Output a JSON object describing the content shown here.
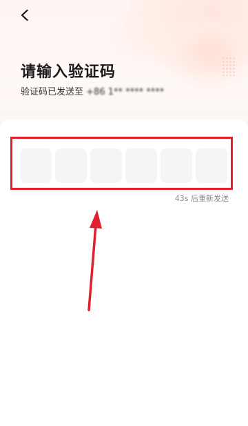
{
  "header": {
    "back_icon": "chevron-left-icon"
  },
  "main": {
    "title": "请输入验证码",
    "subtitle_prefix": "验证码已发送至",
    "phone_number": "+86 1** **** ****",
    "code_length": 6,
    "code_digits": [
      "",
      "",
      "",
      "",
      "",
      ""
    ],
    "resend_countdown": "43s",
    "resend_label": "后重新发送"
  },
  "annotation": {
    "highlight_color": "#e0202c",
    "arrow_color": "#e0202c"
  },
  "colors": {
    "accent": "#e0202c",
    "title_text": "#1a1a1a",
    "code_box_bg": "#f5f5f5",
    "muted_text": "#8a8a8a"
  }
}
